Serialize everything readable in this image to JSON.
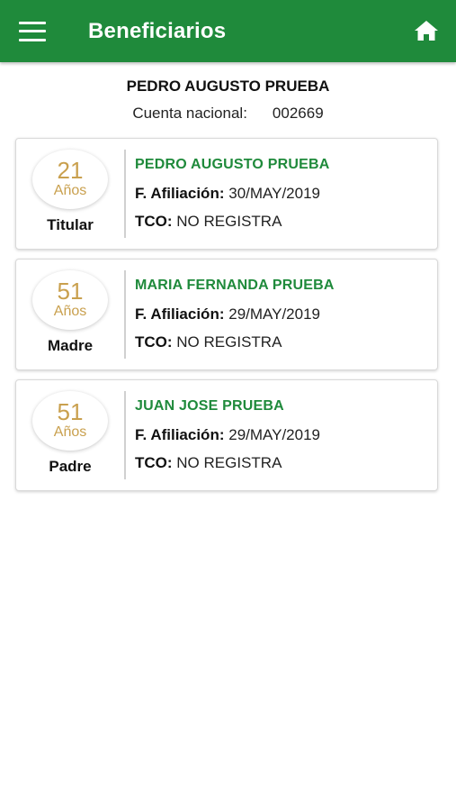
{
  "app_bar": {
    "title": "Beneficiarios",
    "menu_icon": "hamburger-menu-icon",
    "home_icon": "home-icon",
    "color": "#1f8a3b"
  },
  "holder": {
    "name": "PEDRO AUGUSTO PRUEBA",
    "account_label": "Cuenta nacional:",
    "account_value": "002669"
  },
  "beneficiaries": [
    {
      "age": "21",
      "age_unit": "Años",
      "relation": "Titular",
      "name": "PEDRO AUGUSTO PRUEBA",
      "affiliation_label": "F. Afiliación:",
      "affiliation_date": "30/MAY/2019",
      "tco_label": "TCO:",
      "tco_value": "NO REGISTRA"
    },
    {
      "age": "51",
      "age_unit": "Años",
      "relation": "Madre",
      "name": "MARIA FERNANDA PRUEBA",
      "affiliation_label": "F. Afiliación:",
      "affiliation_date": "29/MAY/2019",
      "tco_label": "TCO:",
      "tco_value": "NO REGISTRA"
    },
    {
      "age": "51",
      "age_unit": "Años",
      "relation": "Padre",
      "name": "JUAN JOSE PRUEBA",
      "affiliation_label": "F. Afiliación:",
      "affiliation_date": "29/MAY/2019",
      "tco_label": "TCO:",
      "tco_value": "NO REGISTRA"
    }
  ]
}
